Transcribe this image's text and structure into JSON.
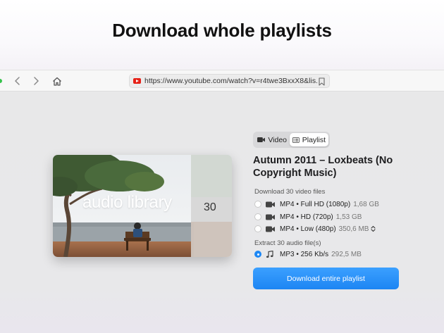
{
  "headline": "Download whole playlists",
  "browser": {
    "url": "https://www.youtube.com/watch?v=r4twe3BxxX8&lis...",
    "icons": [
      "back-icon",
      "forward-icon",
      "home-icon",
      "youtube-icon",
      "bookmark-icon"
    ]
  },
  "thumbnail": {
    "title": "audio library",
    "count": "30"
  },
  "mode_switch": {
    "video_label": "Video",
    "playlist_label": "Playlist",
    "selected": "Playlist"
  },
  "playlist_title": "Autumn 2011 – Loxbeats (No Copyright Music)",
  "video_section": {
    "label": "Download 30 video files",
    "options": [
      {
        "format": "MP4 • Full HD (1080p)",
        "size": "1,68 GB",
        "selected": false
      },
      {
        "format": "MP4 • HD (720p)",
        "size": "1,53 GB",
        "selected": false
      },
      {
        "format": "MP4 • Low (480p)",
        "size": "350,6 MB",
        "selected": false
      }
    ]
  },
  "audio_section": {
    "label": "Extract 30 audio file(s)",
    "options": [
      {
        "format": "MP3 • 256 Kb/s",
        "size": "292,5 MB",
        "selected": true
      }
    ]
  },
  "download_button": "Download entire playlist",
  "colors": {
    "accent": "#1e88f5",
    "background": "#e8e8e9"
  }
}
